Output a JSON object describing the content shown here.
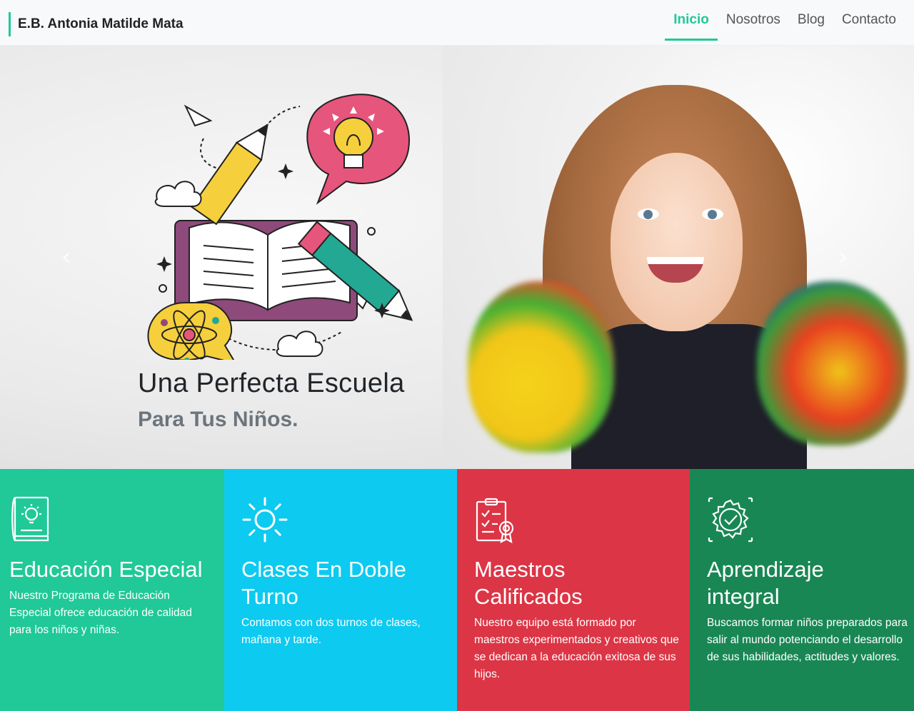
{
  "navbar": {
    "brand": "E.B. Antonia Matilde Mata",
    "links": [
      {
        "label": "Inicio",
        "active": true
      },
      {
        "label": "Nosotros",
        "active": false
      },
      {
        "label": "Blog",
        "active": false
      },
      {
        "label": "Contacto",
        "active": false
      }
    ]
  },
  "hero": {
    "title": "Una Perfecta Escuela",
    "subtitle": "Para Tus Niños.",
    "prev_icon": "chevron-left-icon",
    "next_icon": "chevron-right-icon"
  },
  "features": [
    {
      "icon": "book-idea-icon",
      "title": "Educación Especial",
      "text": "Nuestro Programa de Educación Especial ofrece educación de calidad para los niños y niñas.",
      "color": "#20c997"
    },
    {
      "icon": "sun-icon",
      "title": "Clases En Doble Turno",
      "text": "Contamos con dos turnos de clases, mañana y tarde.",
      "color": "#0dcaf0"
    },
    {
      "icon": "certificate-icon",
      "title": "Maestros Calificados",
      "text": "Nuestro equipo está formado por maestros experimentados y creativos que se dedican a la educación exitosa de sus hijos.",
      "color": "#dc3545"
    },
    {
      "icon": "gear-check-icon",
      "title": "Aprendizaje integral",
      "text": "Buscamos formar niños preparados para salir al mundo potenciando el desarrollo de sus habilidades, actitudes y valores.",
      "color": "#198754"
    }
  ]
}
